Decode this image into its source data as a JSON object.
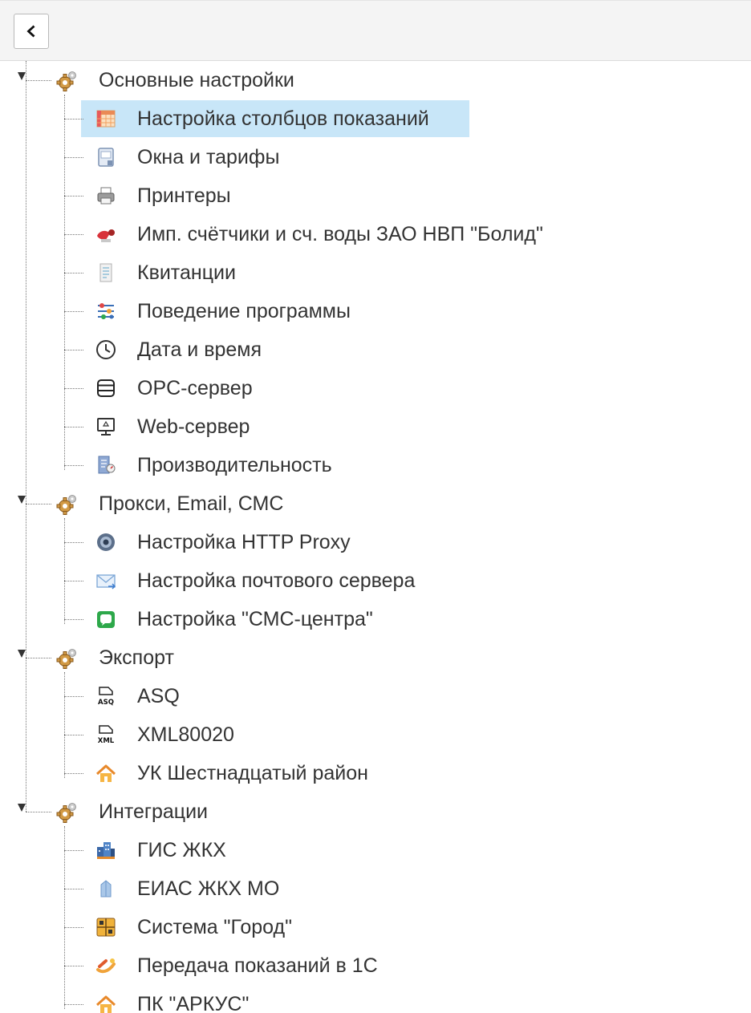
{
  "toolbar": {
    "back_icon": "chevron-left-icon"
  },
  "tree": {
    "groups": [
      {
        "label": "Основные настройки",
        "icon": "gear-icon",
        "items": [
          {
            "label": "Настройка столбцов показаний",
            "icon": "table-columns-icon",
            "selected": true
          },
          {
            "label": "Окна и тарифы",
            "icon": "window-icon"
          },
          {
            "label": "Принтеры",
            "icon": "printer-icon"
          },
          {
            "label": "Имп. счётчики и сч. воды ЗАО НВП \"Болид\"",
            "icon": "meter-icon"
          },
          {
            "label": "Квитанции",
            "icon": "receipt-icon"
          },
          {
            "label": "Поведение программы",
            "icon": "behavior-settings-icon"
          },
          {
            "label": "Дата и время",
            "icon": "clock-icon"
          },
          {
            "label": "OPC-сервер",
            "icon": "server-icon"
          },
          {
            "label": "Web-сервер",
            "icon": "monitor-icon"
          },
          {
            "label": "Производительность",
            "icon": "performance-icon"
          }
        ]
      },
      {
        "label": "Прокси, Email, СМС",
        "icon": "gear-icon",
        "items": [
          {
            "label": "Настройка HTTP Proxy",
            "icon": "proxy-icon"
          },
          {
            "label": "Настройка почтового сервера",
            "icon": "mail-icon"
          },
          {
            "label": "Настройка \"СМС-центра\"",
            "icon": "sms-icon"
          }
        ]
      },
      {
        "label": "Экспорт",
        "icon": "gear-icon",
        "items": [
          {
            "label": "ASQ",
            "icon": "asq-file-icon"
          },
          {
            "label": "XML80020",
            "icon": "xml-file-icon"
          },
          {
            "label": "УК Шестнадцатый район",
            "icon": "house-icon"
          }
        ]
      },
      {
        "label": "Интеграции",
        "icon": "gear-icon",
        "items": [
          {
            "label": "ГИС ЖКХ",
            "icon": "buildings-icon"
          },
          {
            "label": "ЕИАС ЖКХ МО",
            "icon": "eias-icon"
          },
          {
            "label": "Система \"Город\"",
            "icon": "city-system-icon"
          },
          {
            "label": "Передача показаний в 1С",
            "icon": "transfer-icon"
          },
          {
            "label": "ПК \"АРКУС\"",
            "icon": "house-icon"
          }
        ]
      }
    ]
  },
  "colors": {
    "selection": "#c8e6f8",
    "toolbar_bg": "#f4f4f4",
    "text": "#333333"
  }
}
